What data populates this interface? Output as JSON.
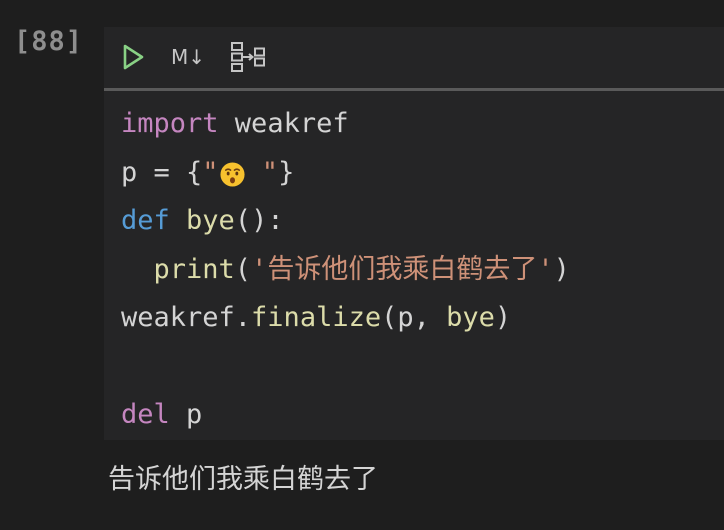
{
  "cell": {
    "execution_count": "[88]",
    "toolbar": {
      "run_icon": "play-icon",
      "markdown_label": "M↓",
      "split_icon": "split-cell-icon"
    },
    "code_lines": [
      {
        "tokens": [
          {
            "t": "import",
            "c": "kw-import"
          },
          {
            "t": " weakref",
            "c": "plain"
          }
        ]
      },
      {
        "tokens": [
          {
            "t": "p = {",
            "c": "plain"
          },
          {
            "t": "\"",
            "c": "str"
          },
          {
            "t": "😯",
            "c": "emoji"
          },
          {
            "t": " \"",
            "c": "str"
          },
          {
            "t": "}",
            "c": "plain"
          }
        ]
      },
      {
        "tokens": [
          {
            "t": "def",
            "c": "kw-def"
          },
          {
            "t": " ",
            "c": "plain"
          },
          {
            "t": "bye",
            "c": "fn"
          },
          {
            "t": "():",
            "c": "plain"
          }
        ]
      },
      {
        "tokens": [
          {
            "t": "  ",
            "c": "plain"
          },
          {
            "t": "print",
            "c": "fn"
          },
          {
            "t": "(",
            "c": "plain"
          },
          {
            "t": "'告诉他们我乘白鹤去了'",
            "c": "str"
          },
          {
            "t": ")",
            "c": "plain"
          }
        ]
      },
      {
        "tokens": [
          {
            "t": "weakref.",
            "c": "plain"
          },
          {
            "t": "finalize",
            "c": "fn"
          },
          {
            "t": "(p, ",
            "c": "plain"
          },
          {
            "t": "bye",
            "c": "fn"
          },
          {
            "t": ")",
            "c": "plain"
          }
        ]
      },
      {
        "tokens": []
      },
      {
        "tokens": [
          {
            "t": "del",
            "c": "kw-import"
          },
          {
            "t": " p",
            "c": "plain"
          }
        ]
      }
    ],
    "output_text": "告诉他们我乘白鹤去了"
  },
  "colors": {
    "background": "#1e1e1e",
    "cell_background": "#252526",
    "keyword_import": "#c586c0",
    "keyword_def": "#569cd6",
    "function": "#dcdcaa",
    "string": "#ce9178",
    "text": "#d4d4d4",
    "run_icon": "#89d185"
  }
}
